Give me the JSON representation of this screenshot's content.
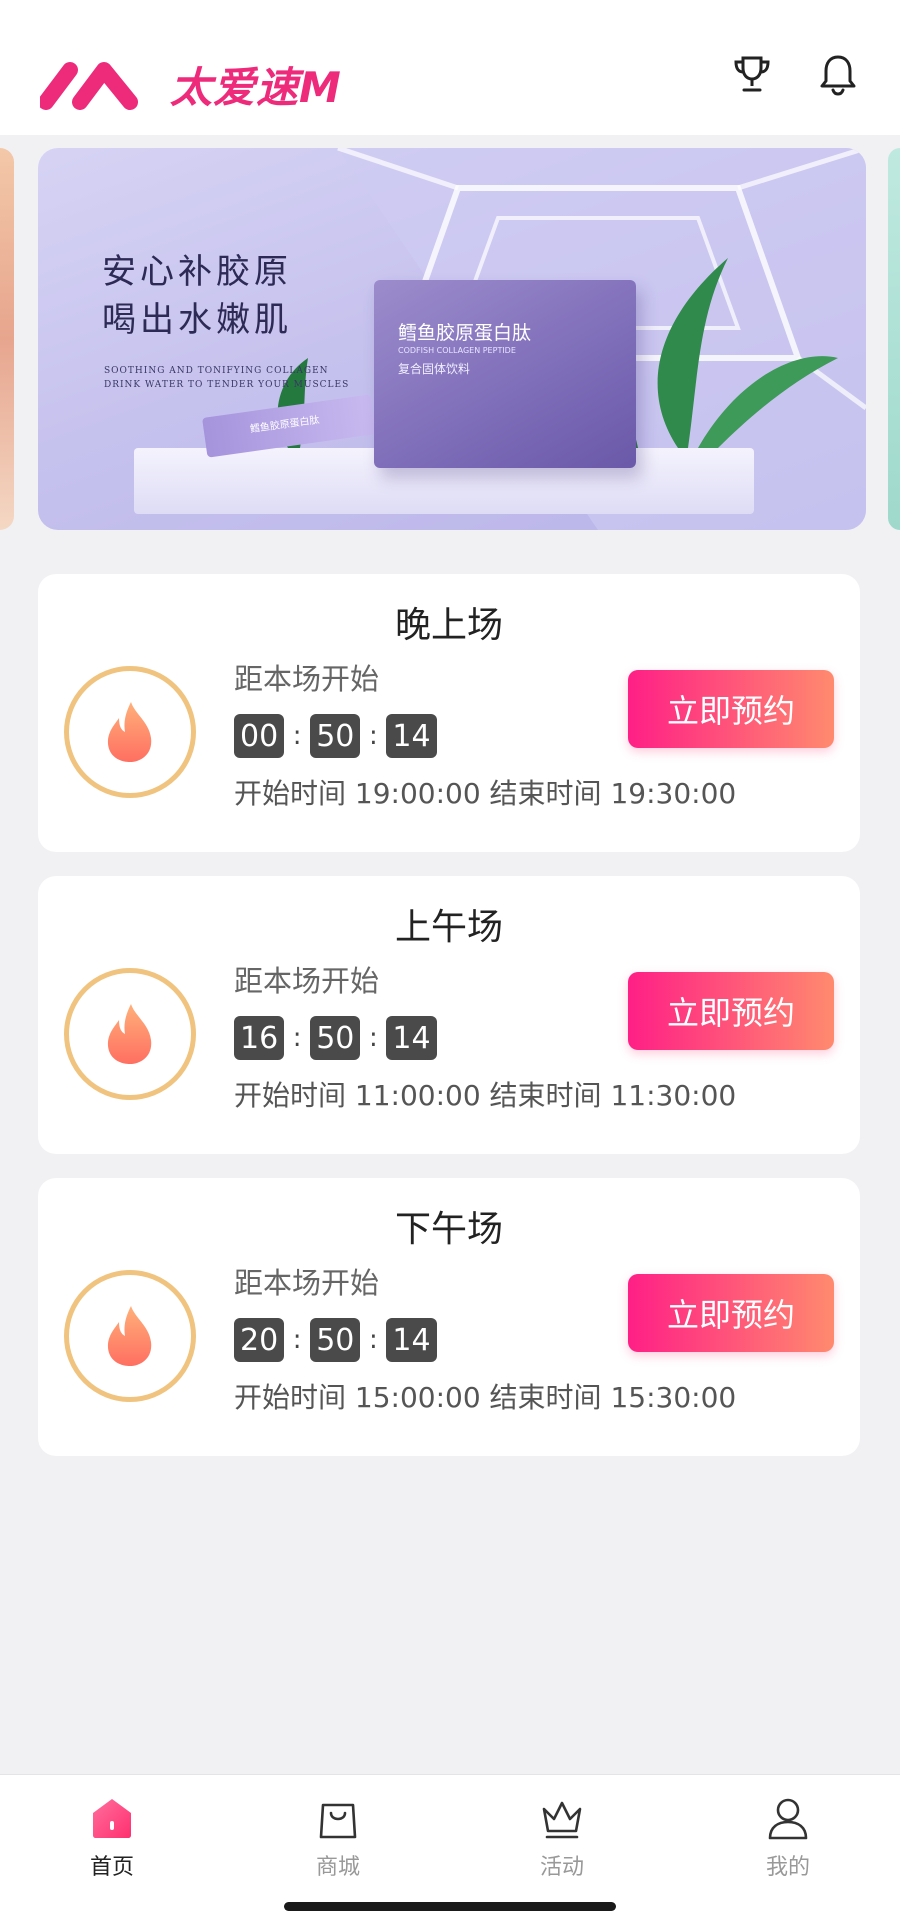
{
  "header": {
    "logo_text": "太爱速M",
    "brand_color": "#ee2a7b",
    "icons": [
      "trophy-icon",
      "bell-icon"
    ]
  },
  "banner": {
    "line1": "安心补胶原",
    "line2": "喝出水嫩肌",
    "en_line1": "SOOTHING AND TONIFYING COLLAGEN",
    "en_line2": "DRINK WATER TO TENDER YOUR MUSCLES",
    "box_title": "鳕鱼胶原蛋白肽",
    "box_en": "CODFISH COLLAGEN PEPTIDE",
    "box_sub": "复合固体饮料",
    "stick_text": "鳕鱼胶原蛋白肽"
  },
  "sessions": [
    {
      "title": "晚上场",
      "label": "距本场开始",
      "countdown": [
        "00",
        "50",
        "14"
      ],
      "time_text": "开始时间 19:00:00 结束时间 19:30:00",
      "button": "立即预约"
    },
    {
      "title": "上午场",
      "label": "距本场开始",
      "countdown": [
        "16",
        "50",
        "14"
      ],
      "time_text": "开始时间 11:00:00 结束时间 11:30:00",
      "button": "立即预约"
    },
    {
      "title": "下午场",
      "label": "距本场开始",
      "countdown": [
        "20",
        "50",
        "14"
      ],
      "time_text": "开始时间 15:00:00 结束时间 15:30:00",
      "button": "立即预约"
    }
  ],
  "countdown_separator": ":",
  "tabs": [
    {
      "label": "首页",
      "icon": "home-icon",
      "active": true
    },
    {
      "label": "商城",
      "icon": "shopping-bag-icon",
      "active": false
    },
    {
      "label": "活动",
      "icon": "crown-icon",
      "active": false
    },
    {
      "label": "我的",
      "icon": "user-icon",
      "active": false
    }
  ],
  "colors": {
    "accent_gradient_start": "#ff1f86",
    "accent_gradient_end": "#ff8a6e",
    "countdown_bg": "#4a4a4a",
    "page_bg": "#f1f1f4"
  }
}
